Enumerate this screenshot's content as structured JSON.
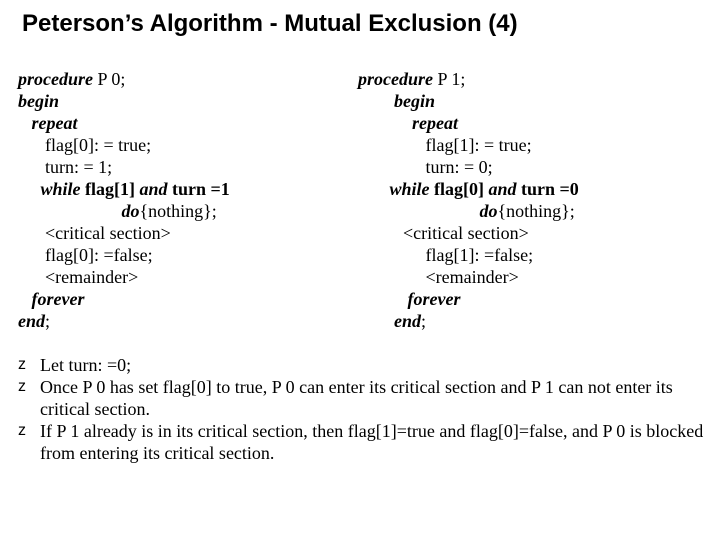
{
  "title": "Peterson’s Algorithm - Mutual Exclusion (4)",
  "left": {
    "l1a": "procedure",
    "l1b": " P 0;",
    "l2": "begin",
    "l3": "repeat",
    "l4": "flag[0]: = true;",
    "l5": "turn: = 1;",
    "l6a": "while",
    "l6b": " flag[1] ",
    "l6c": "and",
    "l6d": " turn =1",
    "l7a": "do",
    "l7b": "{nothing};",
    "l8": "<critical section>",
    "l9": "flag[0]: =false;",
    "l10": "<remainder>",
    "l11": "forever",
    "l12a": "end",
    "l12b": ";"
  },
  "right": {
    "r1a": "procedure",
    "r1b": " P 1;",
    "r2": "begin",
    "r3": "repeat",
    "r4": "flag[1]: = true;",
    "r5": "turn: = 0;",
    "r6a": "while",
    "r6b": " flag[0] ",
    "r6c": "and",
    "r6d": " turn =0",
    "r7a": "do",
    "r7b": "{nothing};",
    "r8": "<critical section>",
    "r9": "flag[1]: =false;",
    "r10": "<remainder>",
    "r11": "forever",
    "r12a": "end",
    "r12b": ";"
  },
  "bullets": {
    "mark": "z",
    "b1": "Let turn: =0;",
    "b2": "Once P 0 has set flag[0] to true, P 0 can enter its critical section and P 1 can not enter its critical section.",
    "b3": "If P 1 already is in its critical section, then flag[1]=true and flag[0]=false, and P 0 is blocked from entering its critical section."
  }
}
